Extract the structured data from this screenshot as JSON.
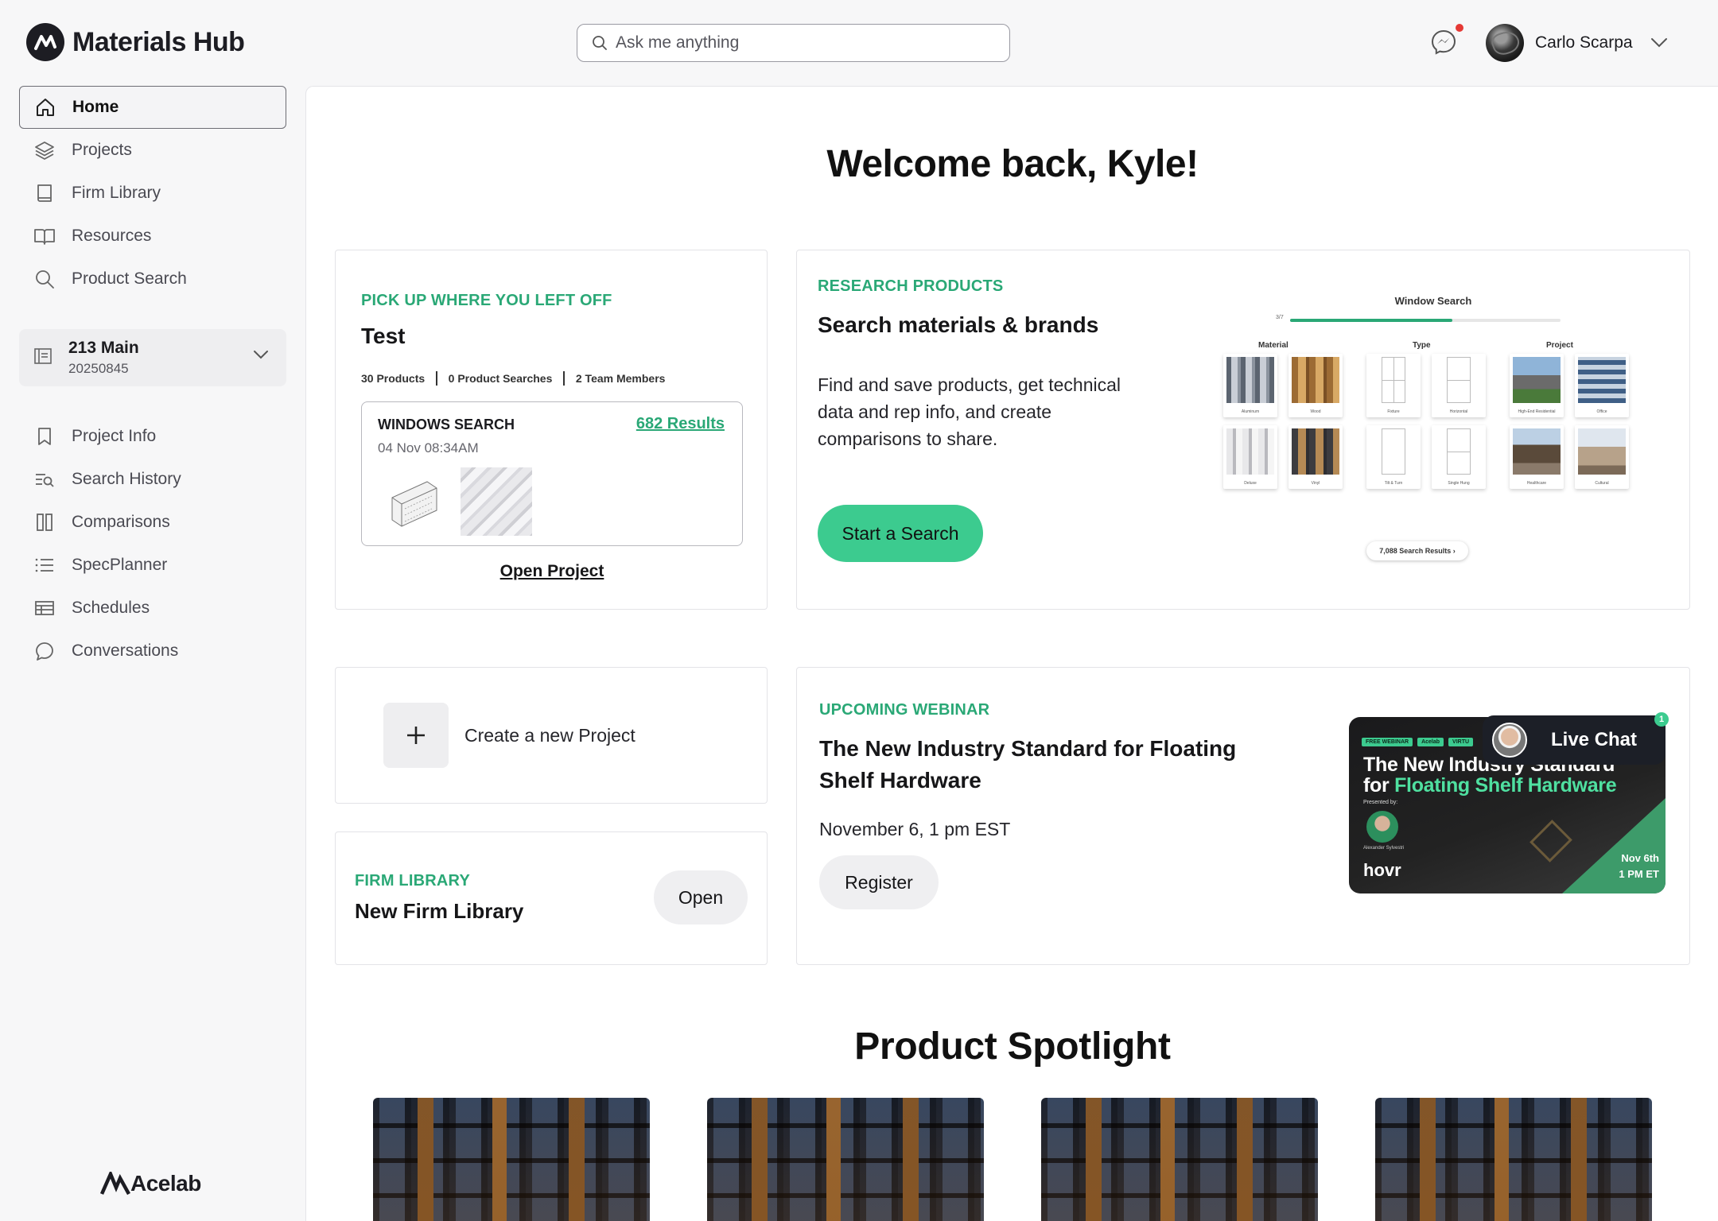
{
  "app": {
    "name": "Materials Hub",
    "footer_brand": "Acelab"
  },
  "search": {
    "placeholder": "Ask me anything"
  },
  "user": {
    "name": "Carlo Scarpa"
  },
  "sidebar": {
    "primary": [
      {
        "label": "Home",
        "icon": "home-icon",
        "active": true
      },
      {
        "label": "Projects",
        "icon": "layers-icon"
      },
      {
        "label": "Firm Library",
        "icon": "book-icon"
      },
      {
        "label": "Resources",
        "icon": "open-book-icon"
      },
      {
        "label": "Product Search",
        "icon": "search-icon"
      }
    ],
    "project": {
      "name": "213 Main",
      "code": "20250845"
    },
    "project_nav": [
      {
        "label": "Project Info",
        "icon": "bookmark-icon"
      },
      {
        "label": "Search History",
        "icon": "search-history-icon"
      },
      {
        "label": "Comparisons",
        "icon": "columns-icon"
      },
      {
        "label": "SpecPlanner",
        "icon": "list-icon"
      },
      {
        "label": "Schedules",
        "icon": "table-icon"
      },
      {
        "label": "Conversations",
        "icon": "chat-bubble-icon"
      }
    ]
  },
  "main": {
    "welcome": "Welcome back, Kyle!",
    "pickup": {
      "eyebrow": "PICK UP WHERE YOU LEFT OFF",
      "title": "Test",
      "stats": [
        "30 Products",
        "0 Product Searches",
        "2 Team Members"
      ],
      "search_box": {
        "title": "WINDOWS SEARCH",
        "date": "04 Nov 08:34AM",
        "results": "682 Results"
      },
      "open_label": "Open Project"
    },
    "research": {
      "eyebrow": "RESEARCH PRODUCTS",
      "title": "Search materials & brands",
      "description": "Find and save products, get technical data and rep info, and create comparisons to share.",
      "button": "Start a Search",
      "mock": {
        "title": "Window Search",
        "step": "3/7",
        "columns": [
          "Material",
          "Type",
          "Project"
        ],
        "tiles": [
          "Aluminum",
          "Wood",
          "Fixture",
          "Horizontal",
          "High-End Residential",
          "Office",
          "Deluxe",
          "Vinyl",
          "Tilt & Turn",
          "Single Hung",
          "Healthcare",
          "Cultural"
        ],
        "pill": "7,088 Search Results"
      }
    },
    "create": {
      "label": "Create a new Project"
    },
    "firm": {
      "eyebrow": "FIRM LIBRARY",
      "title": "New Firm Library",
      "button": "Open"
    },
    "webinar": {
      "eyebrow": "UPCOMING WEBINAR",
      "title": "The New Industry Standard for Floating Shelf Hardware",
      "date": "November 6, 1 pm EST",
      "button": "Register",
      "banner": {
        "tags": [
          "FREE WEBINAR",
          "Acelab",
          "VIRTU"
        ],
        "line1": "The New Industry Standard",
        "line2_pre": "for ",
        "line2_accent": "Floating Shelf Hardware",
        "presented": "Presented by:",
        "speaker": "Alexander Sylvestri",
        "brand": "hovr",
        "when_date": "Nov 6th",
        "when_time": "1 PM ET"
      }
    },
    "livechat": {
      "label": "Live Chat",
      "badge": "1"
    },
    "spotlight": {
      "title": "Product Spotlight",
      "cards": 4
    }
  },
  "colors": {
    "accent": "#2aa876",
    "button_green": "#3ccb8f",
    "notification": "#e53935"
  }
}
